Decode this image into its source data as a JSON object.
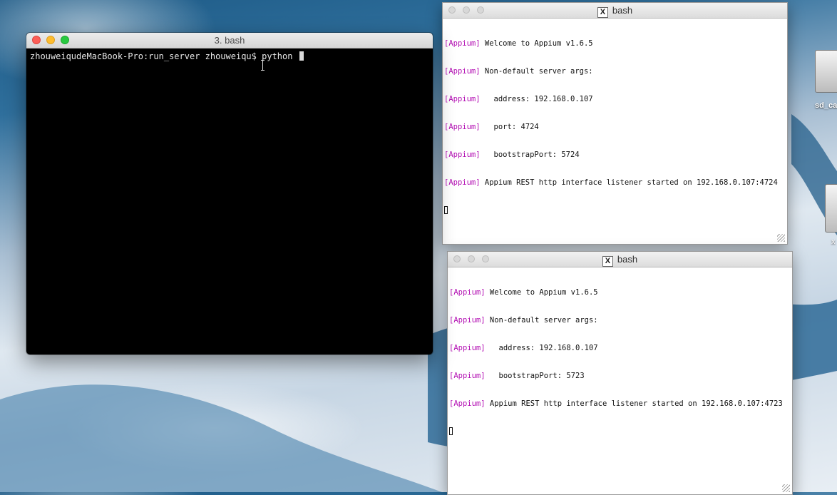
{
  "terminal": {
    "title": "3. bash",
    "prompt": "zhouweiqudeMacBook-Pro:run_server zhouweiqu$ ",
    "typed_command": "python"
  },
  "x_windows": [
    {
      "title": "bash",
      "lines": [
        {
          "tag": "[Appium]",
          "text": " Welcome to Appium v1.6.5"
        },
        {
          "tag": "[Appium]",
          "text": " Non-default server args:"
        },
        {
          "tag": "[Appium]",
          "text": "   address: 192.168.0.107"
        },
        {
          "tag": "[Appium]",
          "text": "   port: 4724"
        },
        {
          "tag": "[Appium]",
          "text": "   bootstrapPort: 5724"
        },
        {
          "tag": "[Appium]",
          "text": " Appium REST http interface listener started on 192.168.0.107:4724"
        }
      ]
    },
    {
      "title": "bash",
      "lines": [
        {
          "tag": "[Appium]",
          "text": " Welcome to Appium v1.6.5"
        },
        {
          "tag": "[Appium]",
          "text": " Non-default server args:"
        },
        {
          "tag": "[Appium]",
          "text": "   address: 192.168.0.107"
        },
        {
          "tag": "[Appium]",
          "text": "   bootstrapPort: 5723"
        },
        {
          "tag": "[Appium]",
          "text": " Appium REST http interface listener started on 192.168.0.107:4723"
        }
      ]
    }
  ],
  "desktop": {
    "icon_label": "sd_ca",
    "second_label": "x"
  },
  "colors": {
    "appium_tag": "#b30fb3",
    "terminal_bg": "#000000"
  }
}
